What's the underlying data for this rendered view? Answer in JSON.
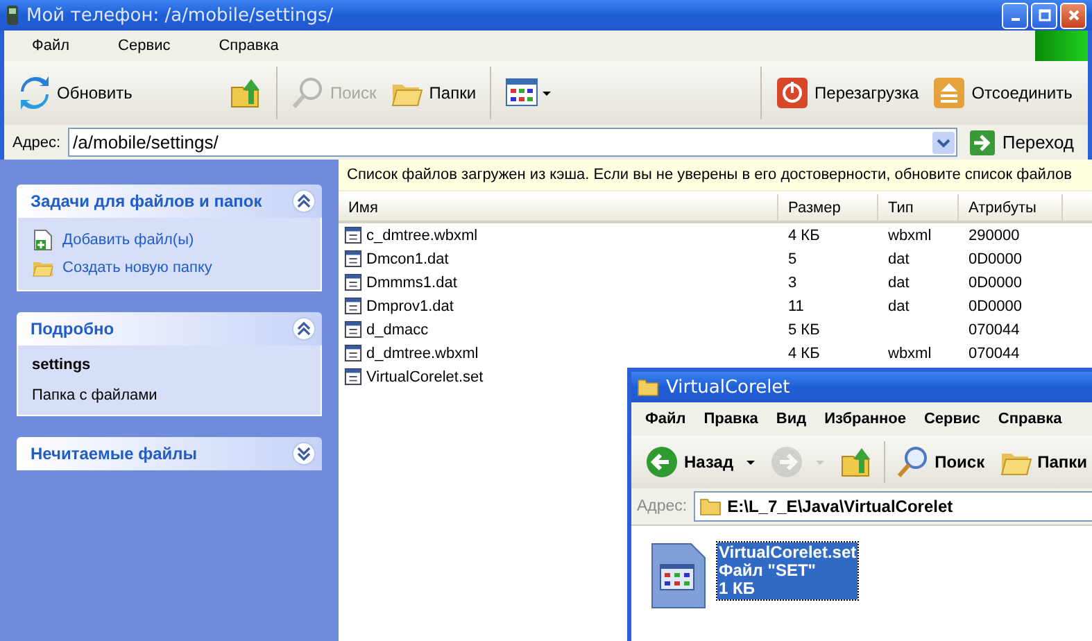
{
  "window": {
    "title": "Мой телефон: /a/mobile/settings/"
  },
  "menu": [
    "Файл",
    "Сервис",
    "Справка"
  ],
  "toolbar": [
    [
      {
        "kind": "refresh",
        "label": "Обновить",
        "disabled": false
      },
      {
        "kind": "up",
        "disabled": false
      }
    ],
    [
      {
        "kind": "search",
        "label": "Поиск",
        "disabled": true
      },
      {
        "kind": "folders",
        "label": "Папки",
        "disabled": false
      }
    ],
    [
      {
        "kind": "views",
        "disabled": false
      }
    ],
    [
      {
        "kind": "restart",
        "label": "Перезагрузка",
        "disabled": false
      },
      {
        "kind": "eject",
        "label": "Отсоединить",
        "disabled": false
      }
    ]
  ],
  "address": {
    "label": "Адрес:",
    "value": "/a/mobile/settings/",
    "go": "Переход"
  },
  "sidebar": [
    {
      "title": "Задачи для файлов и папок",
      "expanded": true,
      "items": [
        {
          "kind": "add",
          "label": "Добавить файл(ы)"
        },
        {
          "kind": "newfolder",
          "label": "Создать новую папку"
        }
      ]
    },
    {
      "title": "Подробно",
      "expanded": true,
      "name": "settings",
      "description": "Папка с файлами"
    },
    {
      "title": "Нечитаемые файлы",
      "expanded": false
    }
  ],
  "notice": "Список файлов загружен из кэша. Если вы не уверены в его достоверности, обновите список файлов",
  "table": {
    "columns": [
      "Имя",
      "Размер",
      "Тип",
      "Атрибуты"
    ],
    "rows": [
      [
        "c_dmtree.wbxml",
        "4 КБ",
        "wbxml",
        "290000"
      ],
      [
        "Dmcon1.dat",
        "5",
        "dat",
        "0D0000"
      ],
      [
        "Dmmms1.dat",
        "3",
        "dat",
        "0D0000"
      ],
      [
        "Dmprov1.dat",
        "11",
        "dat",
        "0D0000"
      ],
      [
        "d_dmacc",
        "5 КБ",
        "",
        "070044"
      ],
      [
        "d_dmtree.wbxml",
        "4 КБ",
        "wbxml",
        "070044"
      ],
      [
        "VirtualCorelet.set",
        "",
        "",
        ""
      ]
    ]
  },
  "explorer": {
    "title": "VirtualCorelet",
    "menu": [
      "Файл",
      "Правка",
      "Вид",
      "Избранное",
      "Сервис",
      "Справка"
    ],
    "toolbar": [
      {
        "kind": "back",
        "label": "Назад",
        "disabled": false,
        "dropdown": true
      },
      {
        "kind": "forward",
        "disabled": true,
        "dropdown": true
      },
      {
        "kind": "up",
        "disabled": false,
        "dropdown": false
      },
      {
        "kind": "search",
        "label": "Поиск",
        "disabled": false,
        "dropdown": false
      },
      {
        "kind": "folders",
        "label": "Папки",
        "disabled": false,
        "dropdown": false
      }
    ],
    "address": {
      "label": "Адрес:",
      "value": "E:\\L_7_E\\Java\\VirtualCorelet"
    },
    "file": {
      "name": "VirtualCorelet.set",
      "type": "Файл \"SET\"",
      "size": "1 КБ",
      "selected": true
    }
  }
}
